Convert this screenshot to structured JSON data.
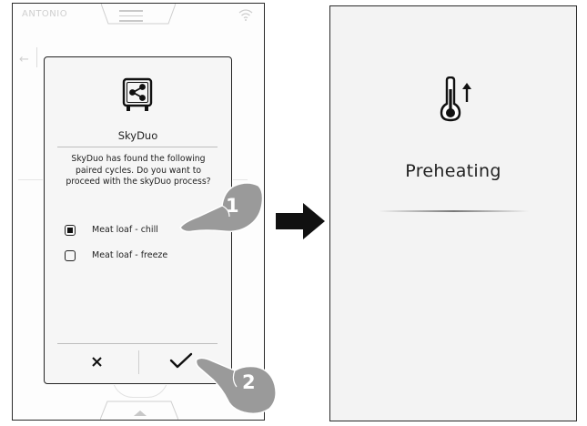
{
  "device": {
    "status_text": "ANTONIO"
  },
  "dialog": {
    "title": "SkyDuo",
    "message_lines": [
      "SkyDuo has found the following",
      "paired cycles. Do you want to",
      "proceed with the skyDuo process?"
    ],
    "options": [
      {
        "label": "Meat loaf - chill",
        "checked": true
      },
      {
        "label": "Meat loaf - freeze",
        "checked": false
      }
    ],
    "cancel_glyph": "✕",
    "confirm_glyph": "✓"
  },
  "steps": {
    "step1": "1",
    "step2": "2"
  },
  "result_screen": {
    "title": "Preheating",
    "icon": "thermometer-up-icon"
  },
  "colors": {
    "hand": "#9a9a9a",
    "arrow": "#111111"
  }
}
